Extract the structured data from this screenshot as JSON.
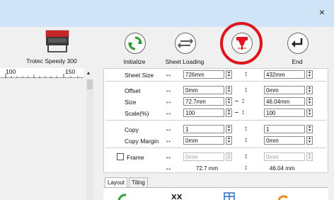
{
  "window": {
    "close_label": "×"
  },
  "device": {
    "name": "Trotec Speedy 300"
  },
  "toolbar": {
    "buttons": [
      {
        "label": "Initialize",
        "icon": "refresh-icon"
      },
      {
        "label": "Sheet Loading",
        "icon": "arrows-icon"
      },
      {
        "label": "",
        "icon": "laser-head-icon"
      },
      {
        "label": "End",
        "icon": "return-icon"
      }
    ],
    "colors": {
      "accent_red": "#e0141c",
      "green": "#2e9b2e",
      "ring": "#e0141c"
    }
  },
  "ruler": {
    "labels": [
      "100",
      "150"
    ]
  },
  "settings": {
    "sheet_size": {
      "label": "Sheet Size",
      "width": "726mm",
      "height": "432mm"
    },
    "offset": {
      "label": "Offset",
      "x": "0mm",
      "y": "0mm"
    },
    "size": {
      "label": "Size",
      "w": "72.7mm",
      "h": "46.04mm"
    },
    "scale": {
      "label": "Scale(%)",
      "x": "100",
      "y": "100"
    },
    "copy": {
      "label": "Copy",
      "x": "1",
      "y": "1"
    },
    "copy_margin": {
      "label": "Copy Margin",
      "x": "0mm",
      "y": "0mm"
    },
    "frame": {
      "label": "Frame",
      "x": "0mm",
      "y": "0mm",
      "checked": false
    },
    "dimensions": {
      "w": "72.7 mm",
      "h": "46.04 mm"
    }
  },
  "tabs": [
    {
      "label": "Layout",
      "active": true
    },
    {
      "label": "Tiling",
      "active": false
    }
  ]
}
